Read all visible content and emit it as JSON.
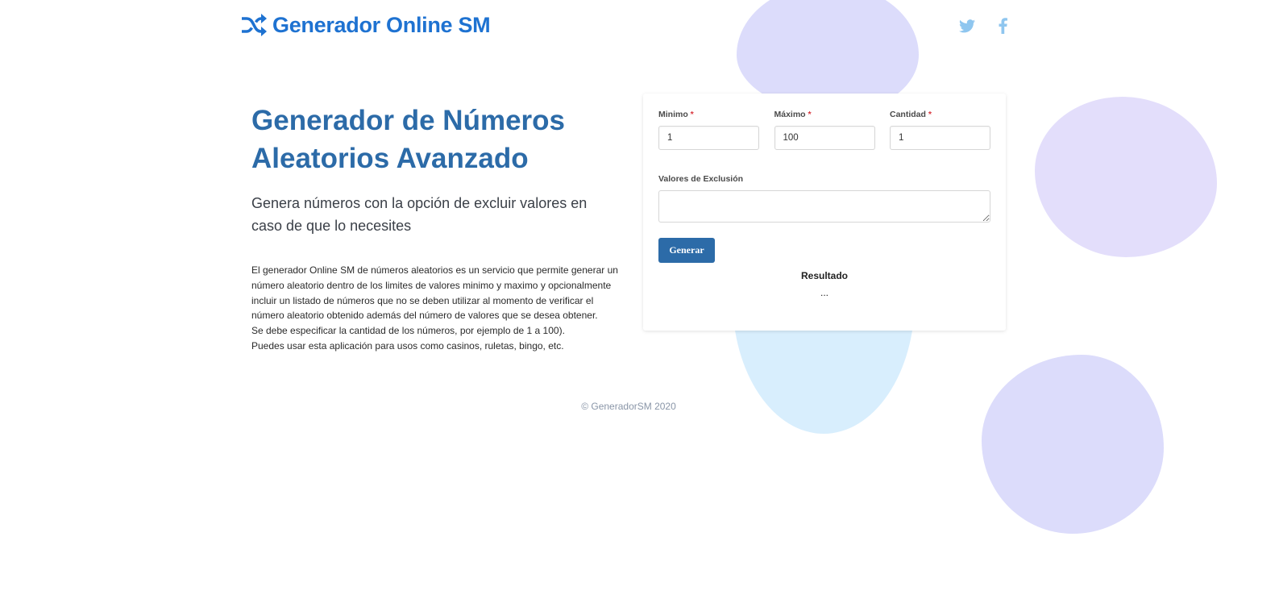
{
  "brand": {
    "name": "Generador Online SM",
    "icon": "shuffle-icon",
    "color": "#1e72d1"
  },
  "social": {
    "twitter_icon": "twitter-icon",
    "facebook_icon": "facebook-icon",
    "color": "#8fc6ef"
  },
  "intro": {
    "title": "Generador de Números Aleatorios Avanzado",
    "subtitle": "Genera números con la opción de excluir valores en caso de que lo necesites",
    "description": [
      "El generador Online SM de números aleatorios es un servicio que permite generar un número aleatorio dentro de los limites de valores minimo y maximo y opcionalmente incluir un listado de números que no se deben utilizar al momento de verificar el número aleatorio obtenido además del número de valores que se desea obtener.",
      "Se debe especificar la cantidad de los números, por ejemplo de 1 a 100).",
      "Puedes usar esta aplicación para usos como casinos, ruletas, bingo, etc."
    ]
  },
  "form": {
    "fields": [
      {
        "label": "Minimo",
        "required_mark": "*",
        "value": "1"
      },
      {
        "label": "Máximo",
        "required_mark": "*",
        "value": "100"
      },
      {
        "label": "Cantidad",
        "required_mark": "*",
        "value": "1"
      }
    ],
    "exclusion_label": "Valores de Exclusión",
    "exclusion_value": "",
    "generate_label": "Generar",
    "result_label": "Resultado",
    "result_value": "..."
  },
  "footer": {
    "text": "© GeneradorSM 2020"
  },
  "colors": {
    "accent": "#2c6ba8",
    "required": "#d9363e",
    "blob_purple": "#dcdcfb",
    "blob_blue": "#d8eefd"
  }
}
